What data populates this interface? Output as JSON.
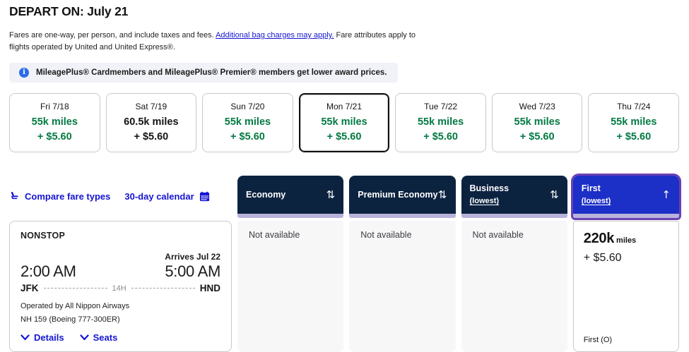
{
  "page": {
    "title": "DEPART ON: July 21"
  },
  "disclaimer": {
    "pre": "Fares are one-way, per person, and include taxes and fees. ",
    "link_text": "Additional bag charges may apply.",
    "post": " Fare attributes apply to flights operated by United and United Express®."
  },
  "banner": {
    "icon": "info-icon",
    "text": "MileagePlus® Cardmembers and MileagePlus® Premier® members get lower award prices."
  },
  "dates": [
    {
      "day": "Fri 7/18",
      "miles": "55k miles",
      "fees": "+ $5.60",
      "highlight": true,
      "selected": false
    },
    {
      "day": "Sat 7/19",
      "miles": "60.5k miles",
      "fees": "+ $5.60",
      "highlight": false,
      "selected": false
    },
    {
      "day": "Sun 7/20",
      "miles": "55k miles",
      "fees": "+ $5.60",
      "highlight": true,
      "selected": false
    },
    {
      "day": "Mon 7/21",
      "miles": "55k miles",
      "fees": "+ $5.60",
      "highlight": true,
      "selected": true
    },
    {
      "day": "Tue 7/22",
      "miles": "55k miles",
      "fees": "+ $5.60",
      "highlight": true,
      "selected": false
    },
    {
      "day": "Wed 7/23",
      "miles": "55k miles",
      "fees": "+ $5.60",
      "highlight": true,
      "selected": false
    },
    {
      "day": "Thu 7/24",
      "miles": "55k miles",
      "fees": "+ $5.60",
      "highlight": true,
      "selected": false
    }
  ],
  "toolbar": {
    "compare_label": "Compare fare types",
    "calendar_label": "30-day calendar",
    "compare_icon": "seat-icon",
    "calendar_icon": "calendar-icon"
  },
  "columns": [
    {
      "label": "Economy",
      "sublabel": "",
      "sort_icon": "⇅",
      "selected": false,
      "status": "Not available"
    },
    {
      "label": "Premium Economy",
      "sublabel": "",
      "sort_icon": "⇅",
      "selected": false,
      "status": "Not available"
    },
    {
      "label": "Business",
      "sublabel": "(lowest)",
      "sort_icon": "⇅",
      "selected": false,
      "status": "Not available"
    },
    {
      "label": "First",
      "sublabel": "(lowest)",
      "sort_icon": "↑",
      "selected": true,
      "award": {
        "miles": "220k",
        "unit": "miles",
        "fees": "+ $5.60"
      },
      "fare_class": "First (O)"
    }
  ],
  "flight": {
    "stops": "NONSTOP",
    "arrival_note": "Arrives Jul 22",
    "depart_time": "2:00 AM",
    "arrive_time": "5:00 AM",
    "origin": "JFK",
    "destination": "HND",
    "duration": "14H",
    "operated_by": "Operated by All Nippon Airways",
    "flight_number": "NH 159 (Boeing 777-300ER)",
    "details_label": "Details",
    "seats_label": "Seats"
  },
  "colors": {
    "award_green": "#047a43",
    "link_blue": "#1414d2",
    "header_navy": "#0c2340",
    "selected_column_blue": "#1c2fc6",
    "selected_column_border_purple": "#6b3fb5",
    "header_strip_lavender": "#b7b3db",
    "info_icon_blue": "#2a6be8"
  }
}
